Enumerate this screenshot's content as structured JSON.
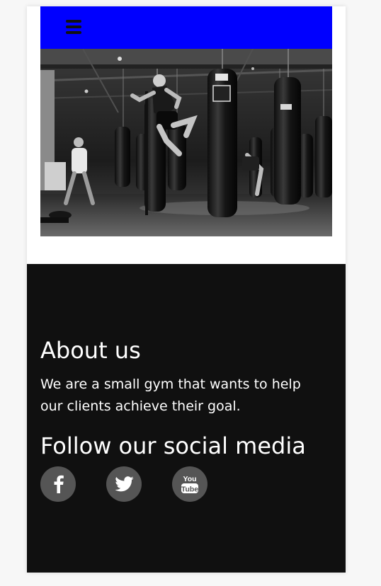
{
  "header": {
    "menu_icon": "hamburger-menu-icon",
    "background_color": "#0000ff"
  },
  "hero": {
    "image_description": "black-and-white boxing gym with hanging heavy bags and a fighter performing a flying knee"
  },
  "about": {
    "title": "About us",
    "text": "We are a small gym that wants to help our clients achieve their goal."
  },
  "social": {
    "title": "Follow our social media",
    "links": [
      {
        "icon": "facebook-icon"
      },
      {
        "icon": "twitter-icon"
      },
      {
        "icon": "youtube-icon",
        "text_top": "You",
        "text_bottom": "Tube"
      }
    ]
  },
  "colors": {
    "footer_background": "#101010",
    "social_button": "#555555",
    "text": "#ffffff"
  }
}
